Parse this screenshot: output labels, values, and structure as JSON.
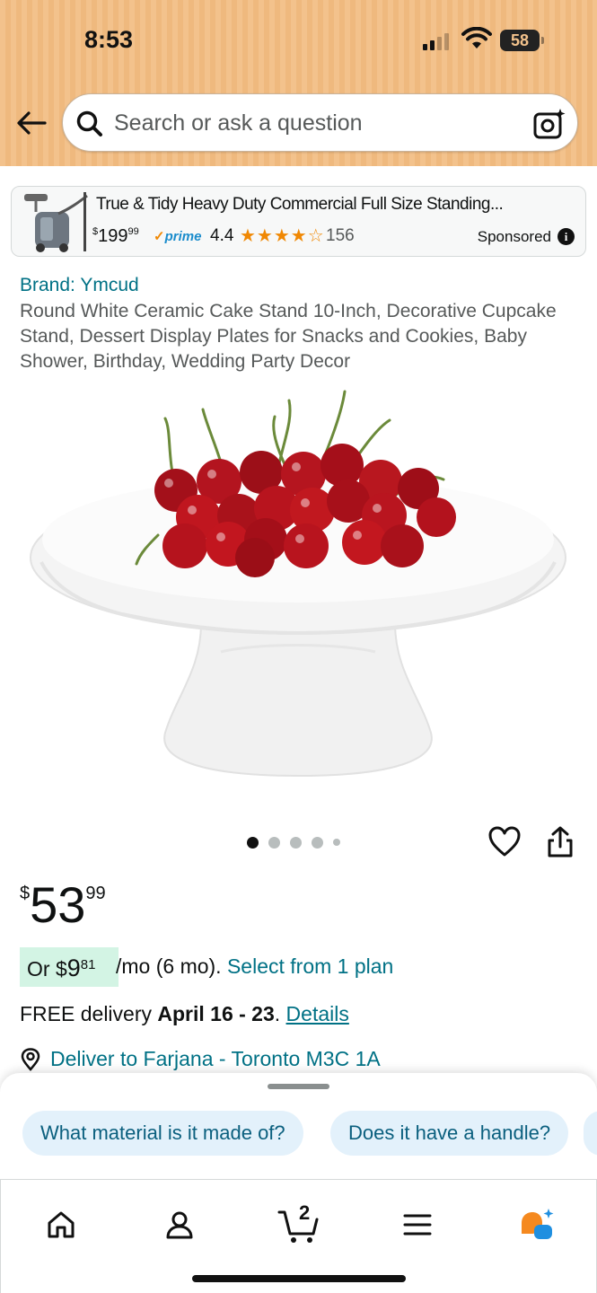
{
  "status_bar": {
    "time": "8:53",
    "battery": "58"
  },
  "search": {
    "placeholder": "Search or ask a question"
  },
  "ad": {
    "title": "True & Tidy Heavy Duty Commercial Full Size Standing...",
    "price_currency": "$",
    "price_whole": "199",
    "price_fraction": "99",
    "prime_label": "prime",
    "rating": "4.4",
    "stars": "★★★★☆",
    "star_value": 4.4,
    "review_count": "156",
    "sponsored_label": "Sponsored",
    "info_icon": "i"
  },
  "product": {
    "brand": "Brand: Ymcud",
    "title": "Round White Ceramic Cake Stand 10-Inch, Decorative Cupcake Stand, Dessert Display Plates for Snacks and Cookies, Baby Shower, Birthday, Wedding Party Decor",
    "image_count": 5,
    "active_image": 1,
    "price_currency": "$",
    "price_whole": "53",
    "price_fraction": "99",
    "installment_prefix": "Or $",
    "installment_whole": "9",
    "installment_fraction": "81",
    "installment_suffix": "/mo (6 mo).",
    "installment_link": "Select from 1 plan",
    "delivery_prefix": "FREE delivery",
    "delivery_dates": "April 16 - 23",
    "delivery_sep": ".",
    "delivery_details": "Details",
    "deliver_to": "Deliver to Farjana - Toronto M3C 1A"
  },
  "rufus": {
    "chips": [
      "What material is it made of?",
      "Does it have a handle?"
    ]
  },
  "nav": {
    "cart_count": "2",
    "items": [
      "home-icon",
      "account-icon",
      "cart-icon",
      "menu-icon",
      "rufus-icon"
    ]
  },
  "colors": {
    "header_bg": "#f3c28c",
    "link": "#007185",
    "star": "#f08804",
    "installment_bg": "#d3f4e4",
    "chip_bg": "#e3f1fb"
  }
}
